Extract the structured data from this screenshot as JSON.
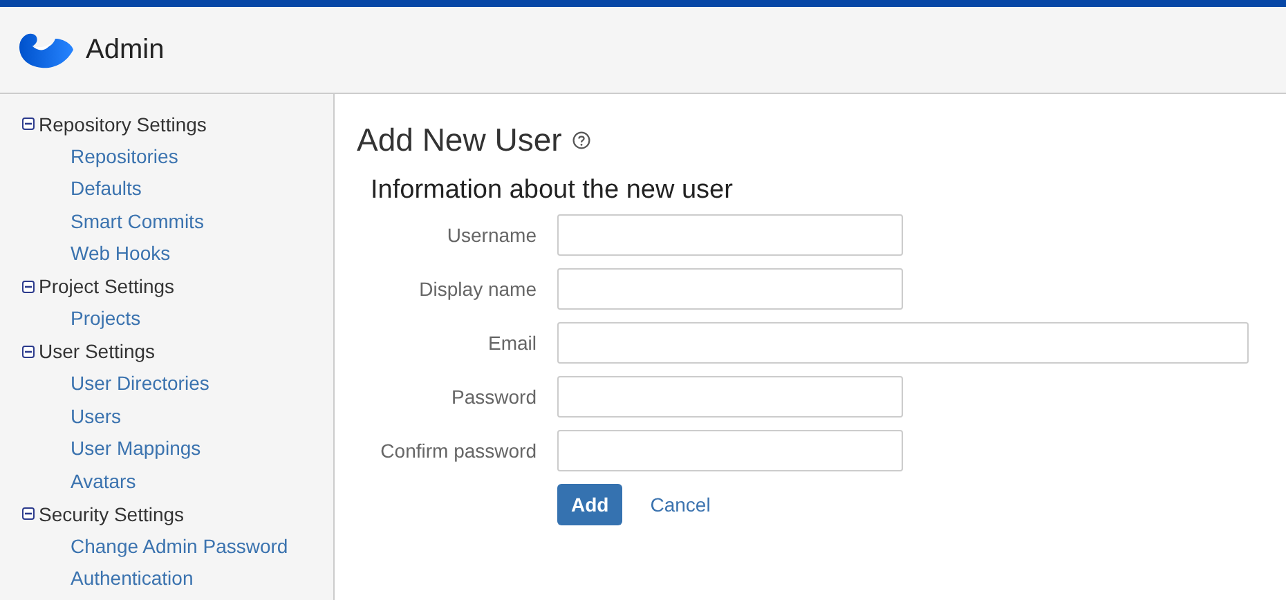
{
  "header": {
    "title": "Admin"
  },
  "sidebar": {
    "groups": [
      {
        "label": "Repository Settings",
        "expanded": true,
        "items": [
          "Repositories",
          "Defaults",
          "Smart Commits",
          "Web Hooks"
        ]
      },
      {
        "label": "Project Settings",
        "expanded": true,
        "items": [
          "Projects"
        ]
      },
      {
        "label": "User Settings",
        "expanded": true,
        "items": [
          "User Directories",
          "Users",
          "User Mappings",
          "Avatars"
        ]
      },
      {
        "label": "Security Settings",
        "expanded": true,
        "items": [
          "Change Admin Password",
          "Authentication"
        ]
      }
    ]
  },
  "page": {
    "title": "Add New User",
    "section_title": "Information about the new user",
    "fields": [
      {
        "label": "Username",
        "kind": "short"
      },
      {
        "label": "Display name",
        "kind": "short"
      },
      {
        "label": "Email",
        "kind": "wide"
      },
      {
        "label": "Password",
        "kind": "short"
      },
      {
        "label": "Confirm password",
        "kind": "short"
      }
    ],
    "buttons": [
      {
        "label": "Add",
        "kind": "primary"
      },
      {
        "label": "Cancel",
        "kind": "link"
      }
    ]
  }
}
